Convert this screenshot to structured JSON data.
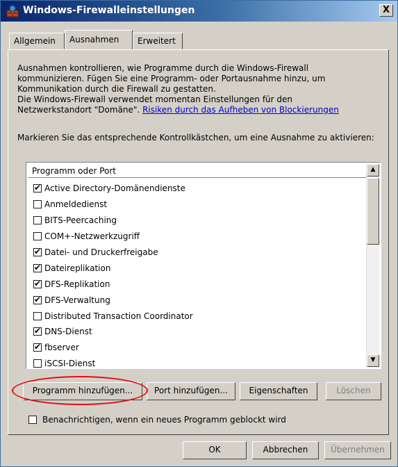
{
  "window": {
    "title": "Windows-Firewalleinstellungen",
    "close_label": "X",
    "icon": "firewall-icon"
  },
  "tabs": [
    {
      "label": "Allgemein",
      "active": false
    },
    {
      "label": "Ausnahmen",
      "active": true
    },
    {
      "label": "Erweitert",
      "active": false
    }
  ],
  "description": {
    "line1": "Ausnahmen kontrollieren, wie Programme durch die Windows-Firewall",
    "line2": "kommunizieren. Fügen Sie eine Programm- oder Portausnahme hinzu, um",
    "line3": "Kommunikation durch die Firewall zu gestatten.",
    "line4": "Die Windows-Firewall verwendet momentan Einstellungen für den",
    "line5_prefix": "Netzwerkstandort \"Domäne\". ",
    "link": "Risiken durch das Aufheben von Blockierungen"
  },
  "instruction": "Markieren Sie das entsprechende Kontrollkästchen, um eine Ausnahme zu aktivieren:",
  "list": {
    "header": "Programm oder Port",
    "items": [
      {
        "label": "Active Directory-Domänendienste",
        "checked": true
      },
      {
        "label": "Anmeldedienst",
        "checked": false
      },
      {
        "label": "BITS-Peercaching",
        "checked": false
      },
      {
        "label": "COM+-Netzwerkzugriff",
        "checked": false
      },
      {
        "label": "Datei- und Druckerfreigabe",
        "checked": true
      },
      {
        "label": "Dateireplikation",
        "checked": true
      },
      {
        "label": "DFS-Replikation",
        "checked": true
      },
      {
        "label": "DFS-Verwaltung",
        "checked": true
      },
      {
        "label": "Distributed Transaction Coordinator",
        "checked": false
      },
      {
        "label": "DNS-Dienst",
        "checked": true
      },
      {
        "label": "fbserver",
        "checked": true
      },
      {
        "label": "iSCSI-Dienst",
        "checked": false
      }
    ]
  },
  "buttons": {
    "add_program": "Programm hinzufügen...",
    "add_port": "Port hinzufügen...",
    "properties": "Eigenschaften",
    "delete": "Löschen"
  },
  "notify_label": "Benachrichtigen, wenn ein neues Programm geblockt wird",
  "footer": {
    "ok": "OK",
    "cancel": "Abbrechen",
    "apply": "Übernehmen"
  },
  "colors": {
    "highlight_ring": "#e01010",
    "link": "#0000cc"
  }
}
